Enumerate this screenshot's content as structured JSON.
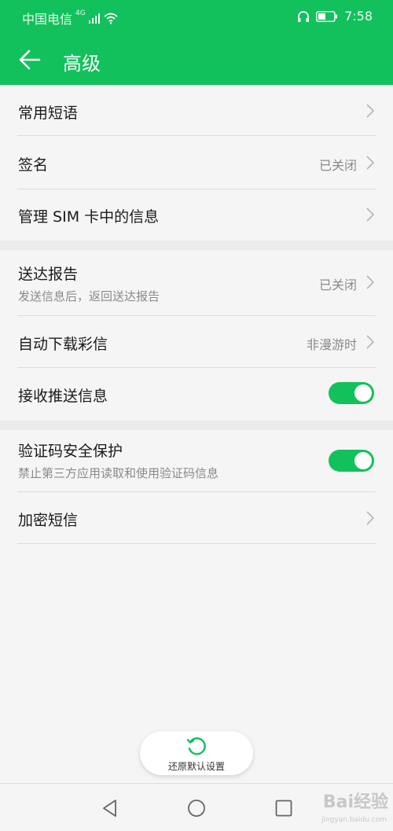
{
  "status_bar": {
    "carrier": "中国电信",
    "network": "4G",
    "time": "7:58"
  },
  "app_bar": {
    "title": "高级",
    "back_icon": "arrow-left-icon"
  },
  "groups": [
    {
      "items": [
        {
          "label": "常用短语",
          "value": "",
          "control": "chevron"
        },
        {
          "label": "签名",
          "value": "已关闭",
          "control": "chevron"
        },
        {
          "label": "管理 SIM 卡中的信息",
          "value": "",
          "control": "chevron"
        }
      ]
    },
    {
      "items": [
        {
          "label": "送达报告",
          "sub": "发送信息后，返回送达报告",
          "value": "已关闭",
          "control": "chevron"
        },
        {
          "label": "自动下载彩信",
          "value": "非漫游时",
          "control": "chevron"
        },
        {
          "label": "接收推送信息",
          "control": "toggle",
          "toggle_on": true
        }
      ]
    },
    {
      "items": [
        {
          "label": "验证码安全保护",
          "sub": "禁止第三方应用读取和使用验证码信息",
          "control": "toggle",
          "toggle_on": true
        },
        {
          "label": "加密短信",
          "value": "",
          "control": "chevron"
        }
      ]
    }
  ],
  "restore_button": {
    "label": "还原默认设置",
    "icon": "refresh-icon"
  },
  "nav_bar": {
    "back": "triangle-back-icon",
    "home": "circle-home-icon",
    "recents": "square-recents-icon"
  },
  "watermark": {
    "text": "Bai经验",
    "sub": "jingyan.baidu.com"
  },
  "colors": {
    "accent": "#12c15b",
    "background": "#f5f5f5"
  }
}
